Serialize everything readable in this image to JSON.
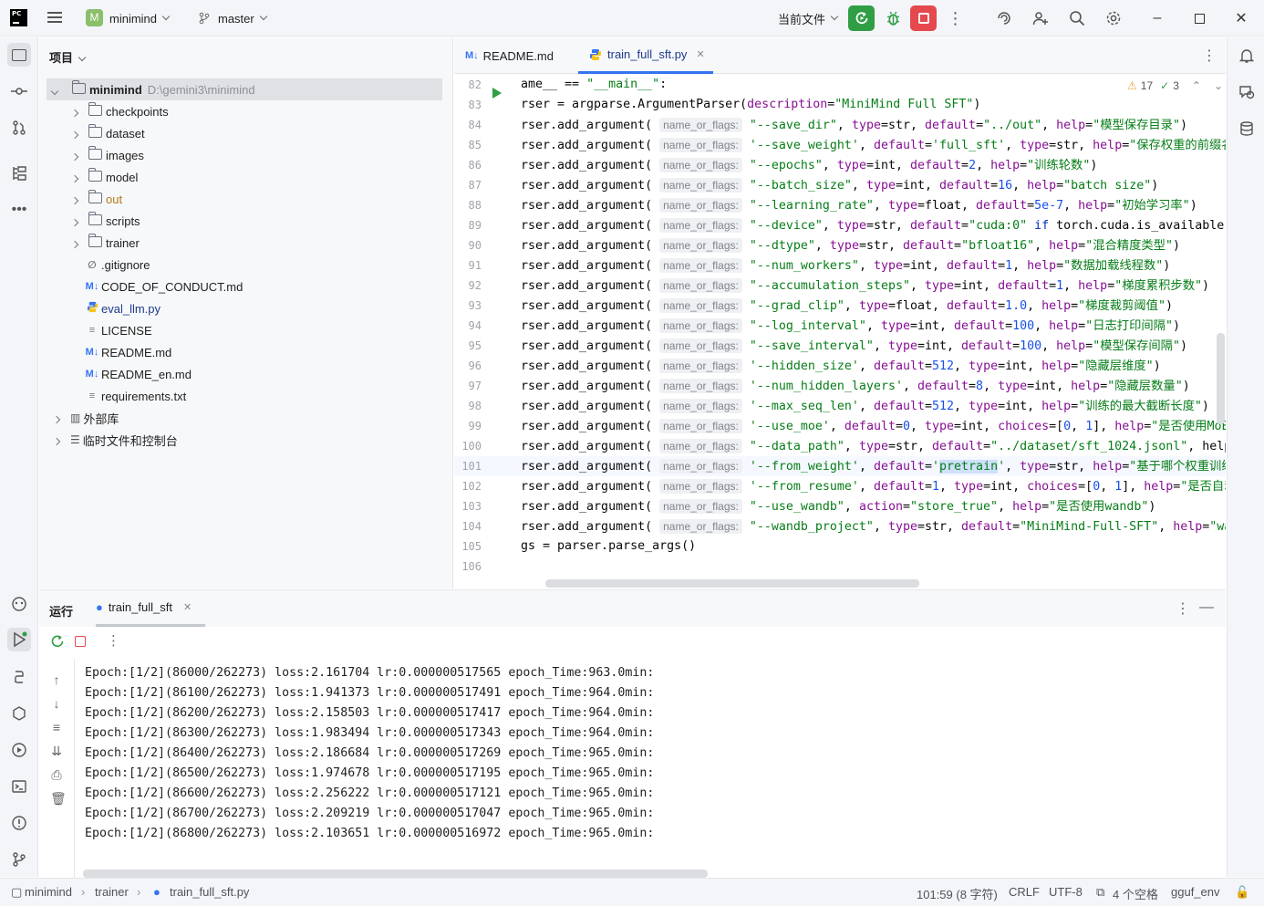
{
  "titlebar": {
    "project": "minimind",
    "project_letter": "M",
    "branch": "master",
    "run_config": "当前文件"
  },
  "project_panel": {
    "title": "项目",
    "root_name": "minimind",
    "root_path": "D:\\gemini3\\minimind",
    "folders": [
      "checkpoints",
      "dataset",
      "images",
      "model",
      "out",
      "scripts",
      "trainer"
    ],
    "files": [
      ".gitignore",
      "CODE_OF_CONDUCT.md",
      "eval_llm.py",
      "LICENSE",
      "README.md",
      "README_en.md",
      "requirements.txt"
    ],
    "external": "外部库",
    "scratches": "临时文件和控制台"
  },
  "tabs": [
    {
      "label": "README.md",
      "icon": "M↓"
    },
    {
      "label": "train_full_sft.py",
      "icon": "py"
    }
  ],
  "inspections": {
    "warnings": "17",
    "ok": "3"
  },
  "code": {
    "lines": [
      {
        "n": "82",
        "t": "ame__ == \"__main__\":"
      },
      {
        "n": "83",
        "t": "rser = argparse.ArgumentParser(description=\"MiniMind Full SFT\")"
      },
      {
        "n": "84",
        "t": "rser.add_argument( \"--save_dir\", type=str, default=\"../out\", help=\"模型保存目录\")"
      },
      {
        "n": "85",
        "t": "rser.add_argument( '--save_weight', default='full_sft', type=str, help=\"保存权重的前缀名"
      },
      {
        "n": "86",
        "t": "rser.add_argument( \"--epochs\", type=int, default=2, help=\"训练轮数\")"
      },
      {
        "n": "87",
        "t": "rser.add_argument( \"--batch_size\", type=int, default=16, help=\"batch size\")"
      },
      {
        "n": "88",
        "t": "rser.add_argument( \"--learning_rate\", type=float, default=5e-7, help=\"初始学习率\")"
      },
      {
        "n": "89",
        "t": "rser.add_argument( \"--device\", type=str, default=\"cuda:0\" if torch.cuda.is_available("
      },
      {
        "n": "90",
        "t": "rser.add_argument( \"--dtype\", type=str, default=\"bfloat16\", help=\"混合精度类型\")"
      },
      {
        "n": "91",
        "t": "rser.add_argument( \"--num_workers\", type=int, default=1, help=\"数据加载线程数\")"
      },
      {
        "n": "92",
        "t": "rser.add_argument( \"--accumulation_steps\", type=int, default=1, help=\"梯度累积步数\")"
      },
      {
        "n": "93",
        "t": "rser.add_argument( \"--grad_clip\", type=float, default=1.0, help=\"梯度裁剪阈值\")"
      },
      {
        "n": "94",
        "t": "rser.add_argument( \"--log_interval\", type=int, default=100, help=\"日志打印间隔\")"
      },
      {
        "n": "95",
        "t": "rser.add_argument( \"--save_interval\", type=int, default=100, help=\"模型保存间隔\")"
      },
      {
        "n": "96",
        "t": "rser.add_argument( '--hidden_size', default=512, type=int, help=\"隐藏层维度\")"
      },
      {
        "n": "97",
        "t": "rser.add_argument( '--num_hidden_layers', default=8, type=int, help=\"隐藏层数量\")"
      },
      {
        "n": "98",
        "t": "rser.add_argument( '--max_seq_len', default=512, type=int, help=\"训练的最大截断长度\")"
      },
      {
        "n": "99",
        "t": "rser.add_argument( '--use_moe', default=0, type=int, choices=[0, 1], help=\"是否使用MoE"
      },
      {
        "n": "100",
        "t": "rser.add_argument( \"--data_path\", type=str, default=\"../dataset/sft_1024.jsonl\", help"
      },
      {
        "n": "101",
        "t": "rser.add_argument( '--from_weight', default='pretrain', type=str, help=\"基于哪个权重训练"
      },
      {
        "n": "102",
        "t": "rser.add_argument( '--from_resume', default=1, type=int, choices=[0, 1], help=\"是否自动"
      },
      {
        "n": "103",
        "t": "rser.add_argument( \"--use_wandb\", action=\"store_true\", help=\"是否使用wandb\")"
      },
      {
        "n": "104",
        "t": "rser.add_argument( \"--wandb_project\", type=str, default=\"MiniMind-Full-SFT\", help=\"wa"
      },
      {
        "n": "105",
        "t": "gs = parser.parse_args()"
      },
      {
        "n": "106",
        "t": ""
      }
    ],
    "hint": "name_or_flags:"
  },
  "run": {
    "title": "运行",
    "tab": "train_full_sft",
    "lines": [
      "Epoch:[1/2](86000/262273) loss:2.161704 lr:0.000000517565 epoch_Time:963.0min:",
      "Epoch:[1/2](86100/262273) loss:1.941373 lr:0.000000517491 epoch_Time:964.0min:",
      "Epoch:[1/2](86200/262273) loss:2.158503 lr:0.000000517417 epoch_Time:964.0min:",
      "Epoch:[1/2](86300/262273) loss:1.983494 lr:0.000000517343 epoch_Time:964.0min:",
      "Epoch:[1/2](86400/262273) loss:2.186684 lr:0.000000517269 epoch_Time:965.0min:",
      "Epoch:[1/2](86500/262273) loss:1.974678 lr:0.000000517195 epoch_Time:965.0min:",
      "Epoch:[1/2](86600/262273) loss:2.256222 lr:0.000000517121 epoch_Time:965.0min:",
      "Epoch:[1/2](86700/262273) loss:2.209219 lr:0.000000517047 epoch_Time:965.0min:",
      "Epoch:[1/2](86800/262273) loss:2.103651 lr:0.000000516972 epoch_Time:965.0min:"
    ]
  },
  "status": {
    "crumbs": [
      "minimind",
      "trainer",
      "train_full_sft.py"
    ],
    "position": "101:59 (8 字符)",
    "eol": "CRLF",
    "encoding": "UTF-8",
    "indent": "4 个空格",
    "interpreter": "gguf_env"
  },
  "colors": {
    "accent": "#3574f0",
    "run_green": "#2f9e44",
    "stop_red": "#e5484d"
  }
}
